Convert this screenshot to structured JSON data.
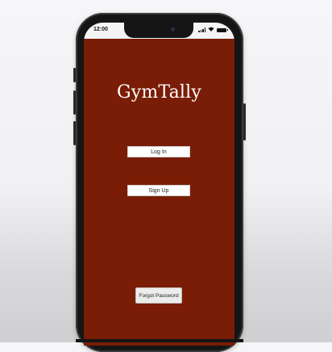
{
  "status_bar": {
    "time": "12:00"
  },
  "app": {
    "title": "GymTally"
  },
  "buttons": {
    "login_label": "Log In",
    "signup_label": "Sign Up",
    "forgot_label": "Forgot Password"
  },
  "colors": {
    "screen_background": "#7a1d06",
    "button_background": "#ffffff",
    "title_text": "#ffffff"
  },
  "icons": [
    "signal-icon",
    "wifi-icon",
    "battery-icon",
    "front-camera-icon"
  ]
}
